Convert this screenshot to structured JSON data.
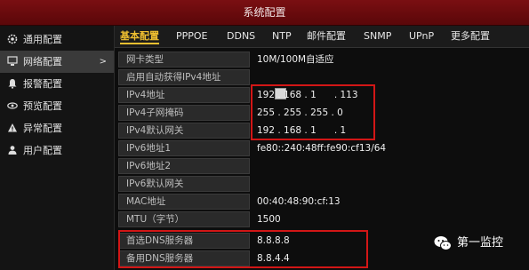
{
  "window": {
    "title": "系统配置"
  },
  "sidebar": {
    "items": [
      {
        "label": "通用配置",
        "icon": "gear-icon"
      },
      {
        "label": "网络配置",
        "icon": "network-icon",
        "active": true
      },
      {
        "label": "报警配置",
        "icon": "alarm-icon"
      },
      {
        "label": "预览配置",
        "icon": "preview-eye-icon"
      },
      {
        "label": "异常配置",
        "icon": "warning-icon"
      },
      {
        "label": "用户配置",
        "icon": "user-icon"
      }
    ],
    "active_arrow": ">"
  },
  "tabs": [
    {
      "label": "基本配置",
      "active": true
    },
    {
      "label": "PPPOE"
    },
    {
      "label": "DDNS"
    },
    {
      "label": "NTP"
    },
    {
      "label": "邮件配置"
    },
    {
      "label": "SNMP"
    },
    {
      "label": "UPnP"
    },
    {
      "label": "更多配置"
    }
  ],
  "fields": [
    {
      "label": "网卡类型",
      "value": "10M/100M自适应"
    },
    {
      "label": "启用自动获得IPv4地址",
      "value": "",
      "type": "checkbox",
      "checked": false
    },
    {
      "label": "IPv4地址",
      "value": "192 . 168 . 1      . 113"
    },
    {
      "label": "IPv4子网掩码",
      "value": "255 . 255 . 255 . 0"
    },
    {
      "label": "IPv4默认网关",
      "value": "192 . 168 . 1      . 1"
    },
    {
      "label": "IPv6地址1",
      "value": "fe80::240:48ff:fe90:cf13/64"
    },
    {
      "label": "IPv6地址2",
      "value": ""
    },
    {
      "label": "IPv6默认网关",
      "value": ""
    },
    {
      "label": "MAC地址",
      "value": "00:40:48:90:cf:13"
    },
    {
      "label": "MTU（字节）",
      "value": "1500"
    },
    {
      "label": "首选DNS服务器",
      "value": "8.8.8.8"
    },
    {
      "label": "备用DNS服务器",
      "value": "8.8.4.4"
    }
  ],
  "watermark": {
    "text": "第一监控"
  },
  "colors": {
    "titlebar": "#6e0b0e",
    "active_tab": "#f0c030",
    "highlight": "#d21616"
  }
}
